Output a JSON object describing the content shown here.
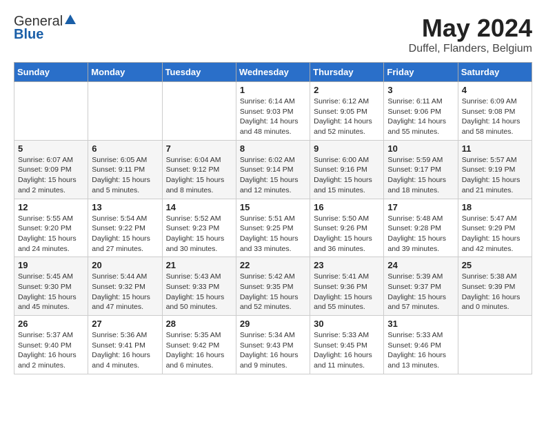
{
  "header": {
    "logo_general": "General",
    "logo_blue": "Blue",
    "month_year": "May 2024",
    "location": "Duffel, Flanders, Belgium"
  },
  "days_of_week": [
    "Sunday",
    "Monday",
    "Tuesday",
    "Wednesday",
    "Thursday",
    "Friday",
    "Saturday"
  ],
  "weeks": [
    {
      "cells": [
        {
          "day": "",
          "info": ""
        },
        {
          "day": "",
          "info": ""
        },
        {
          "day": "",
          "info": ""
        },
        {
          "day": "1",
          "info": "Sunrise: 6:14 AM\nSunset: 9:03 PM\nDaylight: 14 hours and 48 minutes."
        },
        {
          "day": "2",
          "info": "Sunrise: 6:12 AM\nSunset: 9:05 PM\nDaylight: 14 hours and 52 minutes."
        },
        {
          "day": "3",
          "info": "Sunrise: 6:11 AM\nSunset: 9:06 PM\nDaylight: 14 hours and 55 minutes."
        },
        {
          "day": "4",
          "info": "Sunrise: 6:09 AM\nSunset: 9:08 PM\nDaylight: 14 hours and 58 minutes."
        }
      ]
    },
    {
      "cells": [
        {
          "day": "5",
          "info": "Sunrise: 6:07 AM\nSunset: 9:09 PM\nDaylight: 15 hours and 2 minutes."
        },
        {
          "day": "6",
          "info": "Sunrise: 6:05 AM\nSunset: 9:11 PM\nDaylight: 15 hours and 5 minutes."
        },
        {
          "day": "7",
          "info": "Sunrise: 6:04 AM\nSunset: 9:12 PM\nDaylight: 15 hours and 8 minutes."
        },
        {
          "day": "8",
          "info": "Sunrise: 6:02 AM\nSunset: 9:14 PM\nDaylight: 15 hours and 12 minutes."
        },
        {
          "day": "9",
          "info": "Sunrise: 6:00 AM\nSunset: 9:16 PM\nDaylight: 15 hours and 15 minutes."
        },
        {
          "day": "10",
          "info": "Sunrise: 5:59 AM\nSunset: 9:17 PM\nDaylight: 15 hours and 18 minutes."
        },
        {
          "day": "11",
          "info": "Sunrise: 5:57 AM\nSunset: 9:19 PM\nDaylight: 15 hours and 21 minutes."
        }
      ]
    },
    {
      "cells": [
        {
          "day": "12",
          "info": "Sunrise: 5:55 AM\nSunset: 9:20 PM\nDaylight: 15 hours and 24 minutes."
        },
        {
          "day": "13",
          "info": "Sunrise: 5:54 AM\nSunset: 9:22 PM\nDaylight: 15 hours and 27 minutes."
        },
        {
          "day": "14",
          "info": "Sunrise: 5:52 AM\nSunset: 9:23 PM\nDaylight: 15 hours and 30 minutes."
        },
        {
          "day": "15",
          "info": "Sunrise: 5:51 AM\nSunset: 9:25 PM\nDaylight: 15 hours and 33 minutes."
        },
        {
          "day": "16",
          "info": "Sunrise: 5:50 AM\nSunset: 9:26 PM\nDaylight: 15 hours and 36 minutes."
        },
        {
          "day": "17",
          "info": "Sunrise: 5:48 AM\nSunset: 9:28 PM\nDaylight: 15 hours and 39 minutes."
        },
        {
          "day": "18",
          "info": "Sunrise: 5:47 AM\nSunset: 9:29 PM\nDaylight: 15 hours and 42 minutes."
        }
      ]
    },
    {
      "cells": [
        {
          "day": "19",
          "info": "Sunrise: 5:45 AM\nSunset: 9:30 PM\nDaylight: 15 hours and 45 minutes."
        },
        {
          "day": "20",
          "info": "Sunrise: 5:44 AM\nSunset: 9:32 PM\nDaylight: 15 hours and 47 minutes."
        },
        {
          "day": "21",
          "info": "Sunrise: 5:43 AM\nSunset: 9:33 PM\nDaylight: 15 hours and 50 minutes."
        },
        {
          "day": "22",
          "info": "Sunrise: 5:42 AM\nSunset: 9:35 PM\nDaylight: 15 hours and 52 minutes."
        },
        {
          "day": "23",
          "info": "Sunrise: 5:41 AM\nSunset: 9:36 PM\nDaylight: 15 hours and 55 minutes."
        },
        {
          "day": "24",
          "info": "Sunrise: 5:39 AM\nSunset: 9:37 PM\nDaylight: 15 hours and 57 minutes."
        },
        {
          "day": "25",
          "info": "Sunrise: 5:38 AM\nSunset: 9:39 PM\nDaylight: 16 hours and 0 minutes."
        }
      ]
    },
    {
      "cells": [
        {
          "day": "26",
          "info": "Sunrise: 5:37 AM\nSunset: 9:40 PM\nDaylight: 16 hours and 2 minutes."
        },
        {
          "day": "27",
          "info": "Sunrise: 5:36 AM\nSunset: 9:41 PM\nDaylight: 16 hours and 4 minutes."
        },
        {
          "day": "28",
          "info": "Sunrise: 5:35 AM\nSunset: 9:42 PM\nDaylight: 16 hours and 6 minutes."
        },
        {
          "day": "29",
          "info": "Sunrise: 5:34 AM\nSunset: 9:43 PM\nDaylight: 16 hours and 9 minutes."
        },
        {
          "day": "30",
          "info": "Sunrise: 5:33 AM\nSunset: 9:45 PM\nDaylight: 16 hours and 11 minutes."
        },
        {
          "day": "31",
          "info": "Sunrise: 5:33 AM\nSunset: 9:46 PM\nDaylight: 16 hours and 13 minutes."
        },
        {
          "day": "",
          "info": ""
        }
      ]
    }
  ]
}
